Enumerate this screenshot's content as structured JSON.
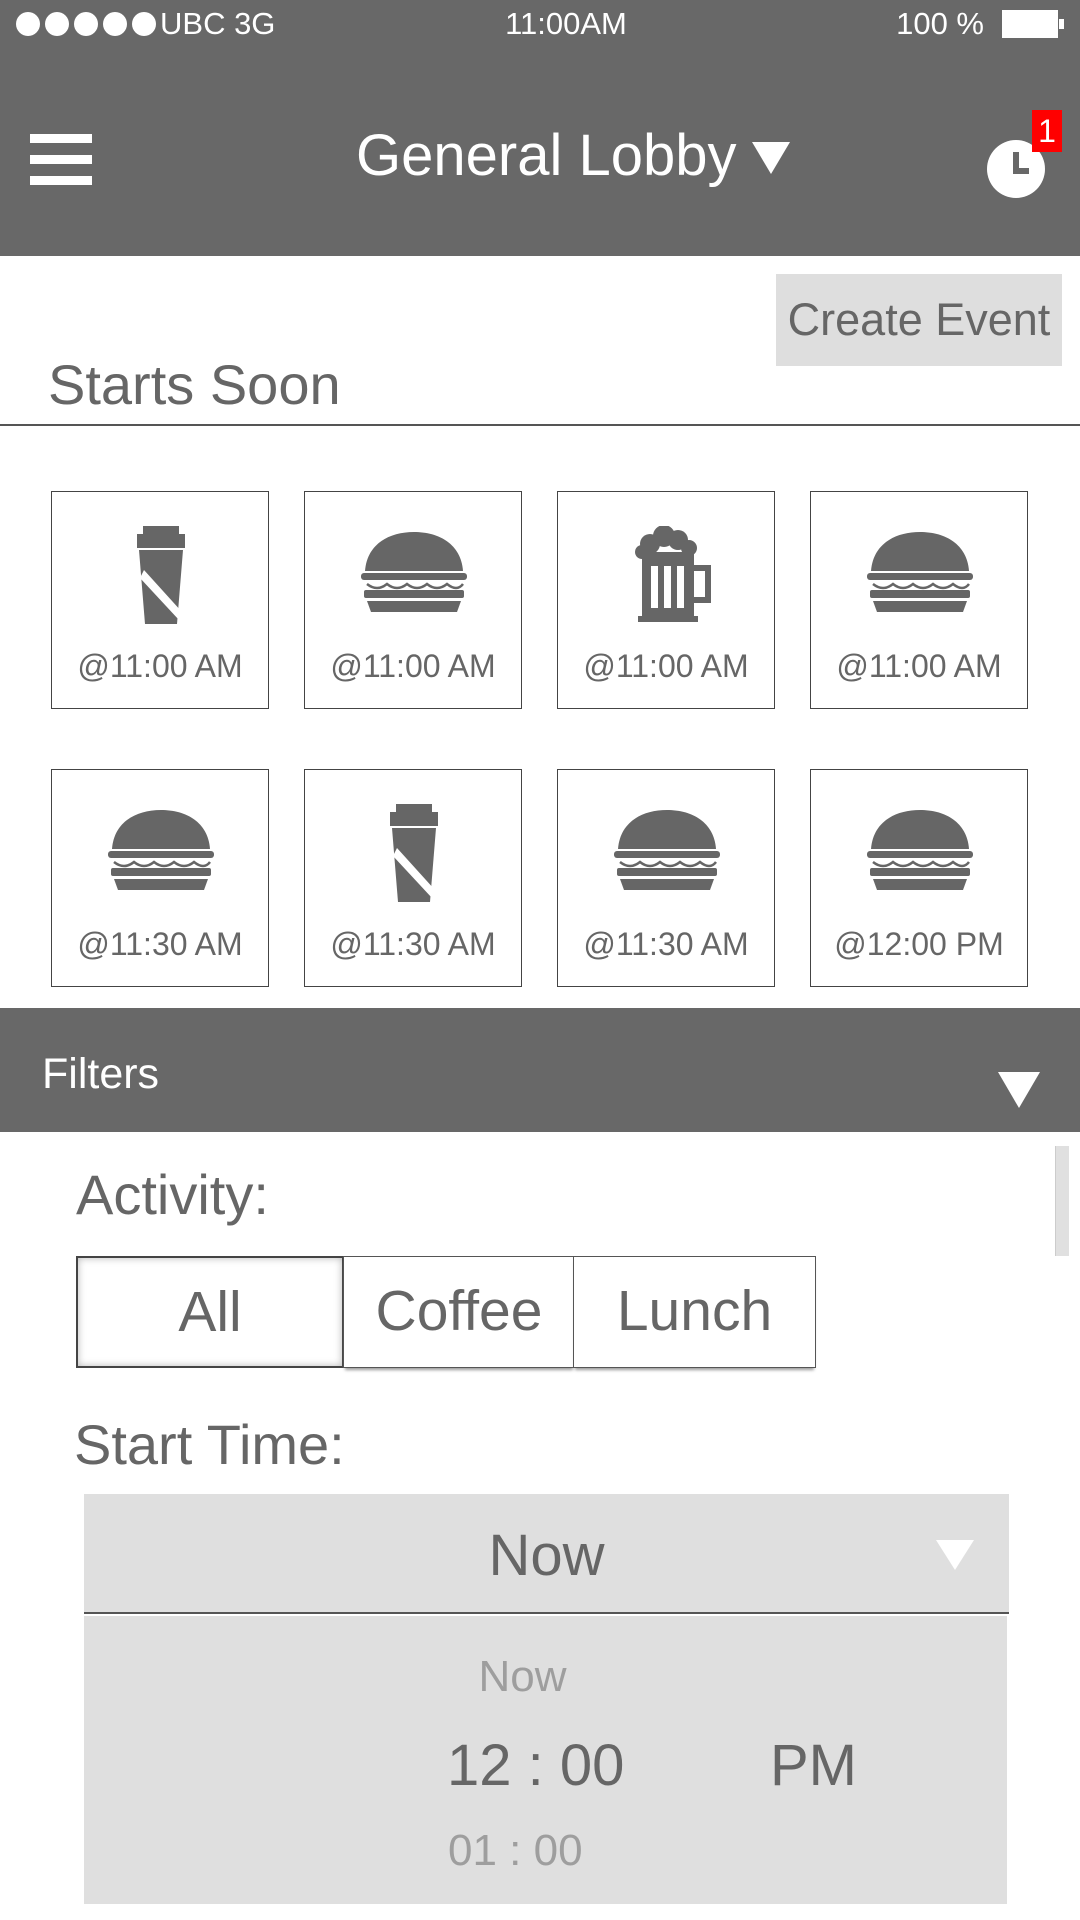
{
  "status_bar": {
    "carrier": "UBC 3G",
    "time": "11:00AM",
    "battery": "100 %"
  },
  "header": {
    "title": "General Lobby",
    "notification_count": "1"
  },
  "create_event_label": "Create Event",
  "section_title": "Starts Soon",
  "events": [
    {
      "icon": "coffee-cup-icon",
      "time": "@11:00 AM"
    },
    {
      "icon": "burger-icon",
      "time": "@11:00 AM"
    },
    {
      "icon": "beer-mug-icon",
      "time": "@11:00 AM"
    },
    {
      "icon": "burger-icon",
      "time": "@11:00 AM"
    },
    {
      "icon": "burger-icon",
      "time": "@11:30 AM"
    },
    {
      "icon": "coffee-cup-icon",
      "time": "@11:30 AM"
    },
    {
      "icon": "burger-icon",
      "time": "@11:30 AM"
    },
    {
      "icon": "burger-icon",
      "time": "@12:00 PM"
    }
  ],
  "filters": {
    "title": "Filters",
    "activity_label": "Activity:",
    "activity_options": [
      "All",
      "Coffee",
      "Lunch"
    ],
    "activity_selected": "All",
    "start_time_label": "Start Time:",
    "start_time_value": "Now",
    "picker": {
      "above": "Now",
      "selected_time": "12 : 00",
      "selected_period": "PM",
      "below": "01 : 00"
    }
  },
  "colors": {
    "header": "#686868",
    "surface": "#dfdfdf",
    "text": "#666666",
    "badge": "#ff0000"
  }
}
